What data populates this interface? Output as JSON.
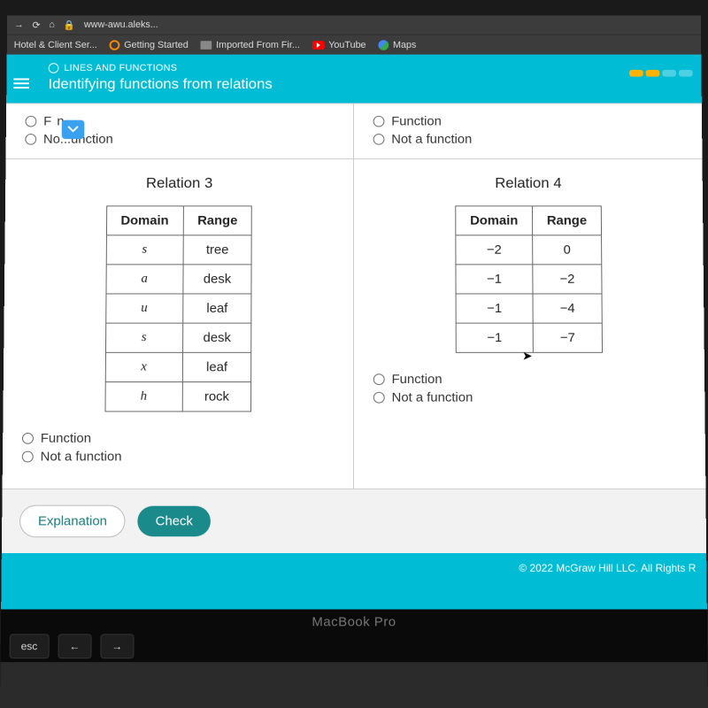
{
  "browser": {
    "url_fragment": "www-awu.aleks...",
    "bookmarks": [
      {
        "label": "Hotel & Client Ser..."
      },
      {
        "label": "Getting Started"
      },
      {
        "label": "Imported From Fir..."
      },
      {
        "label": "YouTube"
      },
      {
        "label": "Maps"
      }
    ]
  },
  "header": {
    "kicker": "LINES AND FUNCTIONS",
    "title": "Identifying functions from relations"
  },
  "top_left": {
    "opt1_label": "F          n",
    "opt2_label": "No...unction"
  },
  "top_right": {
    "opt1_label": "Function",
    "opt2_label": "Not a function"
  },
  "relation3": {
    "title": "Relation 3",
    "headers": [
      "Domain",
      "Range"
    ],
    "rows": [
      {
        "d": "s",
        "r": "tree"
      },
      {
        "d": "a",
        "r": "desk"
      },
      {
        "d": "u",
        "r": "leaf"
      },
      {
        "d": "s",
        "r": "desk"
      },
      {
        "d": "x",
        "r": "leaf"
      },
      {
        "d": "h",
        "r": "rock"
      }
    ],
    "opt1_label": "Function",
    "opt2_label": "Not a function"
  },
  "relation4": {
    "title": "Relation 4",
    "headers": [
      "Domain",
      "Range"
    ],
    "rows": [
      {
        "d": "−2",
        "r": "0"
      },
      {
        "d": "−1",
        "r": "−2"
      },
      {
        "d": "−1",
        "r": "−4"
      },
      {
        "d": "−1",
        "r": "−7"
      }
    ],
    "opt1_label": "Function",
    "opt2_label": "Not a function"
  },
  "footer": {
    "explanation": "Explanation",
    "check": "Check"
  },
  "copyright": "© 2022 McGraw Hill LLC. All Rights R",
  "hw": {
    "brand": "MacBook Pro",
    "esc": "esc"
  }
}
